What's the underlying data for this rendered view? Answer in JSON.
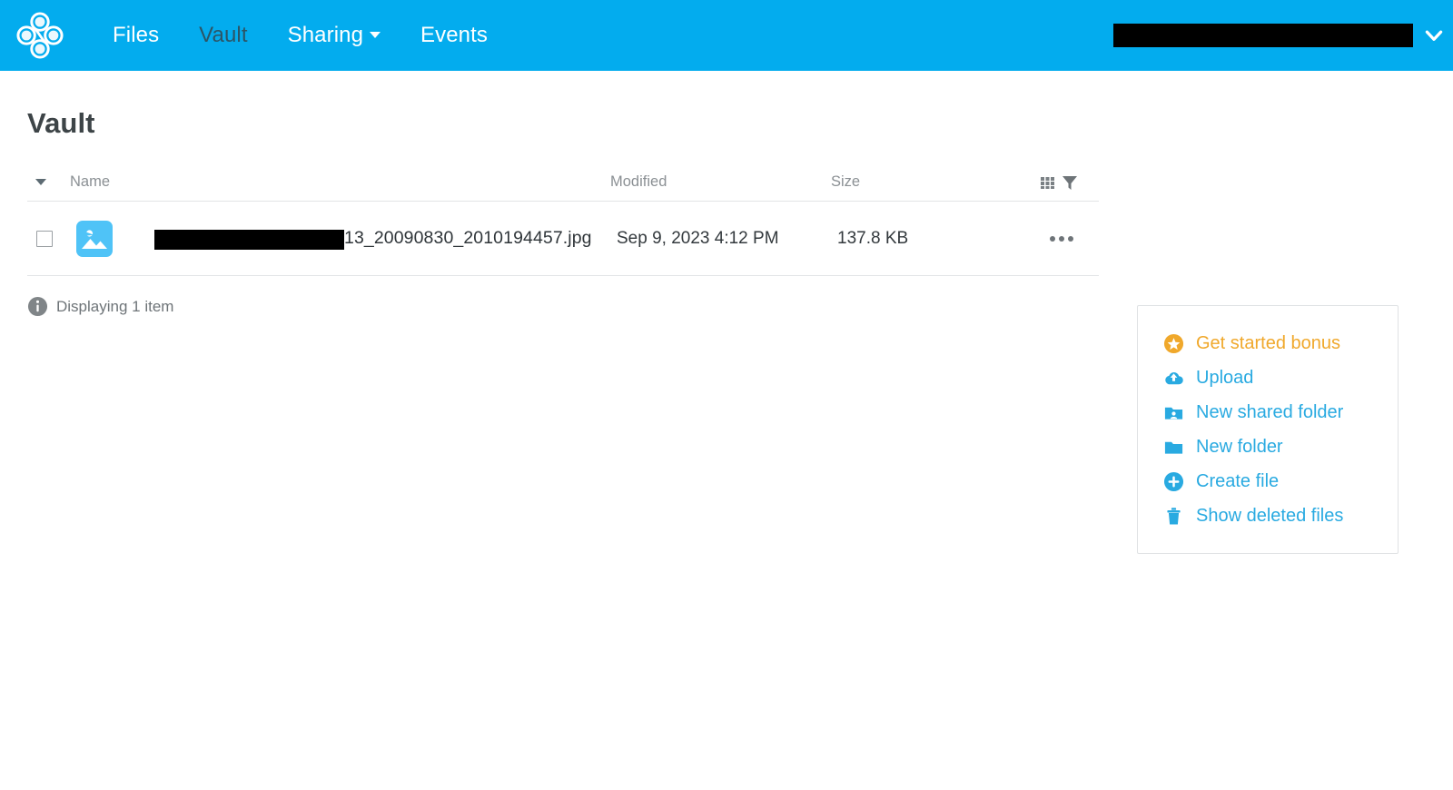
{
  "navbar": {
    "logo_name": "clover-logo",
    "background_color": "#03ACEE",
    "links": [
      {
        "label": "Files",
        "active": false,
        "has_caret": false
      },
      {
        "label": "Vault",
        "active": true,
        "has_caret": false
      },
      {
        "label": "Sharing",
        "active": false,
        "has_caret": true
      },
      {
        "label": "Events",
        "active": false,
        "has_caret": false
      }
    ],
    "user_menu": {
      "label": "",
      "redacted": true,
      "chevron_icon": "chevron-down-icon"
    }
  },
  "page": {
    "title": "Vault"
  },
  "table": {
    "columns": {
      "name": "Name",
      "modified": "Modified",
      "size": "Size"
    },
    "tools": {
      "grid_icon": "grid-view-icon",
      "filter_icon": "filter-funnel-icon"
    },
    "rows": [
      {
        "icon": "image-file-icon",
        "name_redacted": true,
        "name_visible": "13_20090830_2010194457.jpg",
        "modified": "Sep 9, 2023 4:12 PM",
        "size": "137.8 KB",
        "actions_icon": "ellipsis-menu-icon"
      }
    ],
    "status": "Displaying 1 item",
    "status_icon": "info-icon"
  },
  "action_panel": {
    "items": [
      {
        "label": "Get started bonus",
        "icon": "star-badge-icon",
        "color": "#F0A82B"
      },
      {
        "label": "Upload",
        "icon": "cloud-upload-icon",
        "color": "#29AAE1"
      },
      {
        "label": "New shared folder",
        "icon": "shared-folder-icon",
        "color": "#29AAE1"
      },
      {
        "label": "New folder",
        "icon": "folder-icon",
        "color": "#29AAE1"
      },
      {
        "label": "Create file",
        "icon": "plus-circle-icon",
        "color": "#29AAE1"
      },
      {
        "label": "Show deleted files",
        "icon": "trash-icon",
        "color": "#29AAE1"
      }
    ]
  }
}
